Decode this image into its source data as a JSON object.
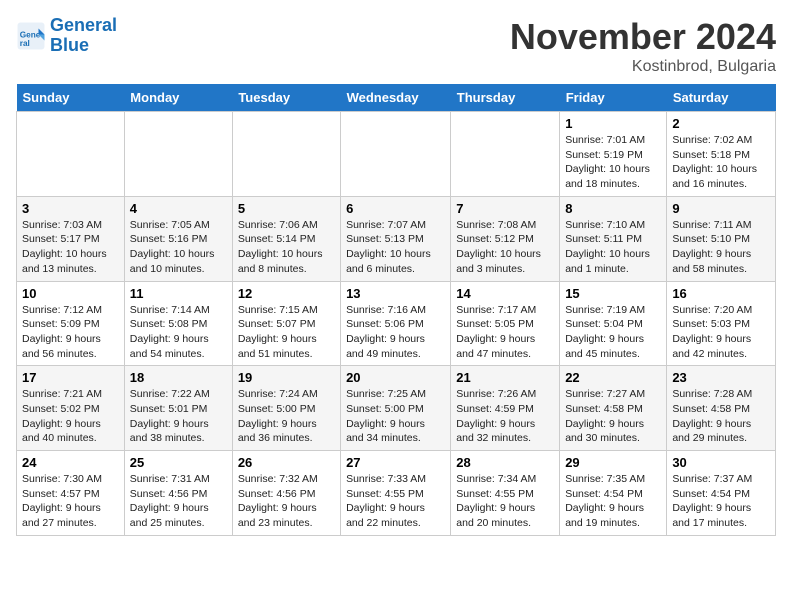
{
  "header": {
    "logo_line1": "General",
    "logo_line2": "Blue",
    "month": "November 2024",
    "location": "Kostinbrod, Bulgaria"
  },
  "weekdays": [
    "Sunday",
    "Monday",
    "Tuesday",
    "Wednesday",
    "Thursday",
    "Friday",
    "Saturday"
  ],
  "weeks": [
    [
      {
        "day": "",
        "info": ""
      },
      {
        "day": "",
        "info": ""
      },
      {
        "day": "",
        "info": ""
      },
      {
        "day": "",
        "info": ""
      },
      {
        "day": "",
        "info": ""
      },
      {
        "day": "1",
        "info": "Sunrise: 7:01 AM\nSunset: 5:19 PM\nDaylight: 10 hours\nand 18 minutes."
      },
      {
        "day": "2",
        "info": "Sunrise: 7:02 AM\nSunset: 5:18 PM\nDaylight: 10 hours\nand 16 minutes."
      }
    ],
    [
      {
        "day": "3",
        "info": "Sunrise: 7:03 AM\nSunset: 5:17 PM\nDaylight: 10 hours\nand 13 minutes."
      },
      {
        "day": "4",
        "info": "Sunrise: 7:05 AM\nSunset: 5:16 PM\nDaylight: 10 hours\nand 10 minutes."
      },
      {
        "day": "5",
        "info": "Sunrise: 7:06 AM\nSunset: 5:14 PM\nDaylight: 10 hours\nand 8 minutes."
      },
      {
        "day": "6",
        "info": "Sunrise: 7:07 AM\nSunset: 5:13 PM\nDaylight: 10 hours\nand 6 minutes."
      },
      {
        "day": "7",
        "info": "Sunrise: 7:08 AM\nSunset: 5:12 PM\nDaylight: 10 hours\nand 3 minutes."
      },
      {
        "day": "8",
        "info": "Sunrise: 7:10 AM\nSunset: 5:11 PM\nDaylight: 10 hours\nand 1 minute."
      },
      {
        "day": "9",
        "info": "Sunrise: 7:11 AM\nSunset: 5:10 PM\nDaylight: 9 hours\nand 58 minutes."
      }
    ],
    [
      {
        "day": "10",
        "info": "Sunrise: 7:12 AM\nSunset: 5:09 PM\nDaylight: 9 hours\nand 56 minutes."
      },
      {
        "day": "11",
        "info": "Sunrise: 7:14 AM\nSunset: 5:08 PM\nDaylight: 9 hours\nand 54 minutes."
      },
      {
        "day": "12",
        "info": "Sunrise: 7:15 AM\nSunset: 5:07 PM\nDaylight: 9 hours\nand 51 minutes."
      },
      {
        "day": "13",
        "info": "Sunrise: 7:16 AM\nSunset: 5:06 PM\nDaylight: 9 hours\nand 49 minutes."
      },
      {
        "day": "14",
        "info": "Sunrise: 7:17 AM\nSunset: 5:05 PM\nDaylight: 9 hours\nand 47 minutes."
      },
      {
        "day": "15",
        "info": "Sunrise: 7:19 AM\nSunset: 5:04 PM\nDaylight: 9 hours\nand 45 minutes."
      },
      {
        "day": "16",
        "info": "Sunrise: 7:20 AM\nSunset: 5:03 PM\nDaylight: 9 hours\nand 42 minutes."
      }
    ],
    [
      {
        "day": "17",
        "info": "Sunrise: 7:21 AM\nSunset: 5:02 PM\nDaylight: 9 hours\nand 40 minutes."
      },
      {
        "day": "18",
        "info": "Sunrise: 7:22 AM\nSunset: 5:01 PM\nDaylight: 9 hours\nand 38 minutes."
      },
      {
        "day": "19",
        "info": "Sunrise: 7:24 AM\nSunset: 5:00 PM\nDaylight: 9 hours\nand 36 minutes."
      },
      {
        "day": "20",
        "info": "Sunrise: 7:25 AM\nSunset: 5:00 PM\nDaylight: 9 hours\nand 34 minutes."
      },
      {
        "day": "21",
        "info": "Sunrise: 7:26 AM\nSunset: 4:59 PM\nDaylight: 9 hours\nand 32 minutes."
      },
      {
        "day": "22",
        "info": "Sunrise: 7:27 AM\nSunset: 4:58 PM\nDaylight: 9 hours\nand 30 minutes."
      },
      {
        "day": "23",
        "info": "Sunrise: 7:28 AM\nSunset: 4:58 PM\nDaylight: 9 hours\nand 29 minutes."
      }
    ],
    [
      {
        "day": "24",
        "info": "Sunrise: 7:30 AM\nSunset: 4:57 PM\nDaylight: 9 hours\nand 27 minutes."
      },
      {
        "day": "25",
        "info": "Sunrise: 7:31 AM\nSunset: 4:56 PM\nDaylight: 9 hours\nand 25 minutes."
      },
      {
        "day": "26",
        "info": "Sunrise: 7:32 AM\nSunset: 4:56 PM\nDaylight: 9 hours\nand 23 minutes."
      },
      {
        "day": "27",
        "info": "Sunrise: 7:33 AM\nSunset: 4:55 PM\nDaylight: 9 hours\nand 22 minutes."
      },
      {
        "day": "28",
        "info": "Sunrise: 7:34 AM\nSunset: 4:55 PM\nDaylight: 9 hours\nand 20 minutes."
      },
      {
        "day": "29",
        "info": "Sunrise: 7:35 AM\nSunset: 4:54 PM\nDaylight: 9 hours\nand 19 minutes."
      },
      {
        "day": "30",
        "info": "Sunrise: 7:37 AM\nSunset: 4:54 PM\nDaylight: 9 hours\nand 17 minutes."
      }
    ]
  ]
}
